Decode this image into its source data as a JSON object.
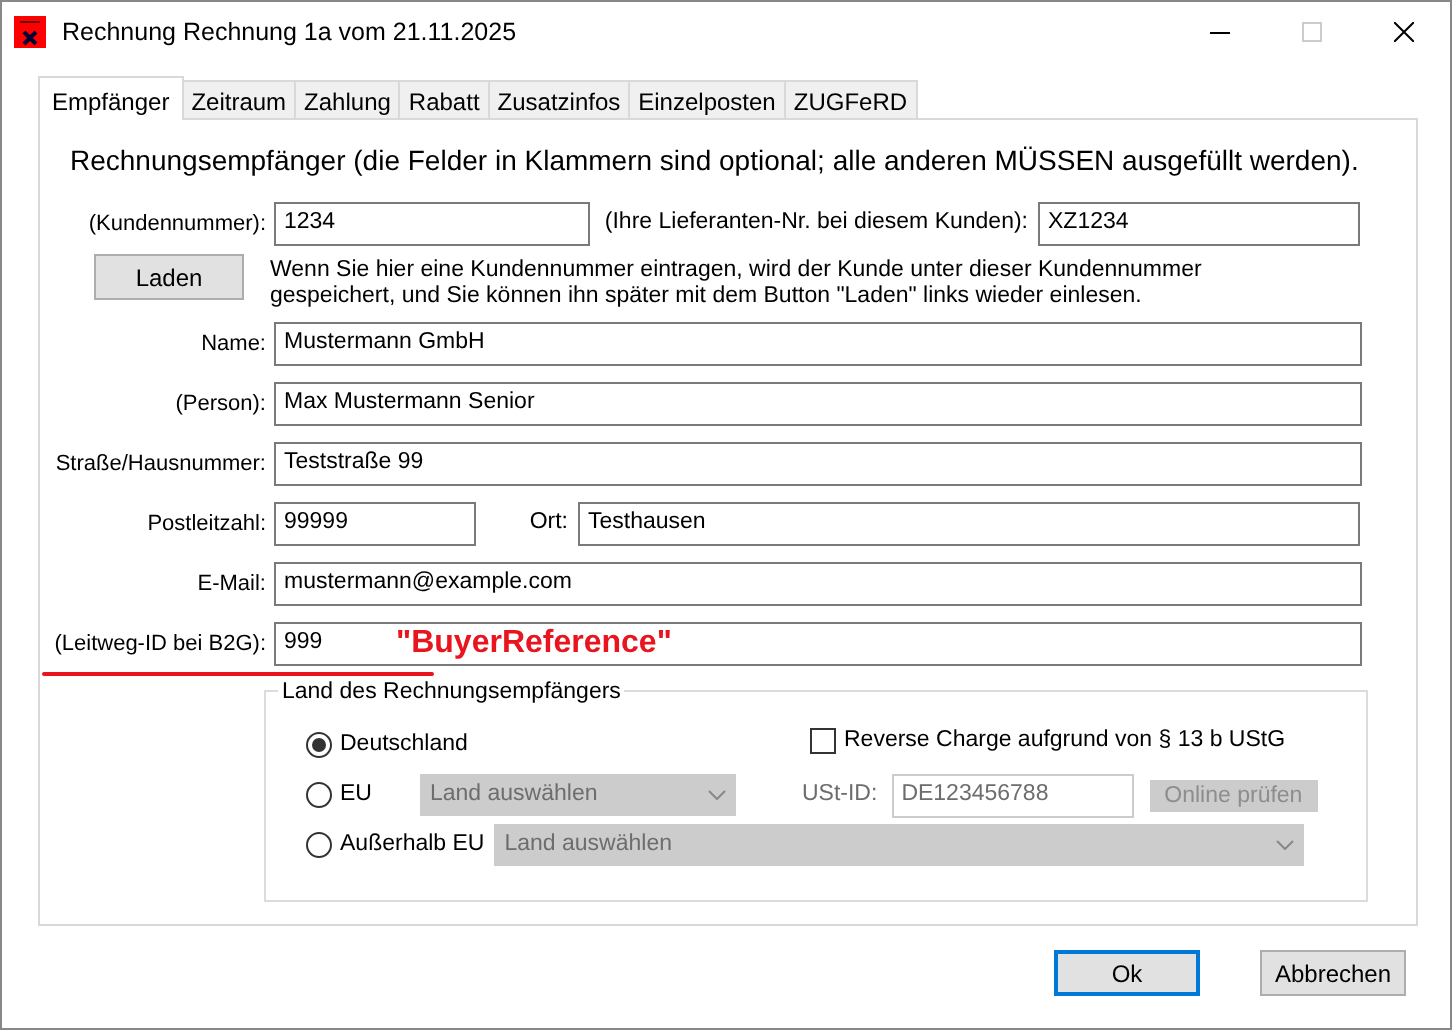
{
  "window": {
    "title": "Rechnung Rechnung 1a vom 21.11.2025"
  },
  "tabs": [
    {
      "label": "Empfänger",
      "selected": true
    },
    {
      "label": "Zeitraum",
      "selected": false
    },
    {
      "label": "Zahlung",
      "selected": false
    },
    {
      "label": "Rabatt",
      "selected": false
    },
    {
      "label": "Zusatzinfos",
      "selected": false
    },
    {
      "label": "Einzelposten",
      "selected": false
    },
    {
      "label": "ZUGFeRD",
      "selected": false
    }
  ],
  "heading": "Rechnungsempfänger (die Felder in Klammern sind optional; alle anderen MÜSSEN ausgefüllt werden).",
  "customer_number": {
    "label": "(Kundennummer):",
    "value": "1234"
  },
  "supplier_number": {
    "label": "(Ihre Lieferanten-Nr. bei diesem Kunden):",
    "value": "XZ1234"
  },
  "load_button": {
    "label": "Laden"
  },
  "hint_lines": [
    "Wenn Sie hier eine Kundennummer eintragen, wird der Kunde unter dieser Kundennummer",
    "gespeichert, und Sie können ihn später mit dem Button \"Laden\" links wieder einlesen."
  ],
  "fields": [
    {
      "kind": "single",
      "label": "Name:",
      "value": "Mustermann GmbH"
    },
    {
      "kind": "single",
      "label": "(Person):",
      "value": "Max Mustermann Senior"
    },
    {
      "kind": "single",
      "label": "Straße/Hausnummer:",
      "value": "Teststraße 99"
    },
    {
      "kind": "pair",
      "label": "Postleitzahl:",
      "value": "99999",
      "label_2": "Ort:",
      "value_2": "Testhausen"
    },
    {
      "kind": "single",
      "label": "E-Mail:",
      "value": "mustermann@example.com"
    },
    {
      "kind": "single",
      "label": "(Leitweg-ID bei B2G):",
      "value": "999",
      "annotation": "\"BuyerReference\""
    }
  ],
  "country_group": {
    "title": "Land des Rechnungsempfängers",
    "options": [
      {
        "kind": "plain",
        "label": "Deutschland",
        "selected": true
      },
      {
        "kind": "select",
        "label": "EU",
        "selected": false,
        "select": "Land auswählen",
        "select_disabled": true
      },
      {
        "kind": "wide-select",
        "label": "Außerhalb EU",
        "selected": false,
        "select": "Land auswählen",
        "select_disabled": true
      }
    ],
    "reverse_charge": {
      "label": "Reverse Charge aufgrund von § 13 b UStG",
      "checked": false
    },
    "vat_id": {
      "label": "USt-ID:",
      "value": "DE123456788",
      "disabled": true
    },
    "check_button": {
      "label": "Online prüfen",
      "disabled": true
    }
  },
  "buttons": [
    {
      "label": "Ok",
      "default": true
    },
    {
      "label": "Abbrechen",
      "default": false
    }
  ]
}
